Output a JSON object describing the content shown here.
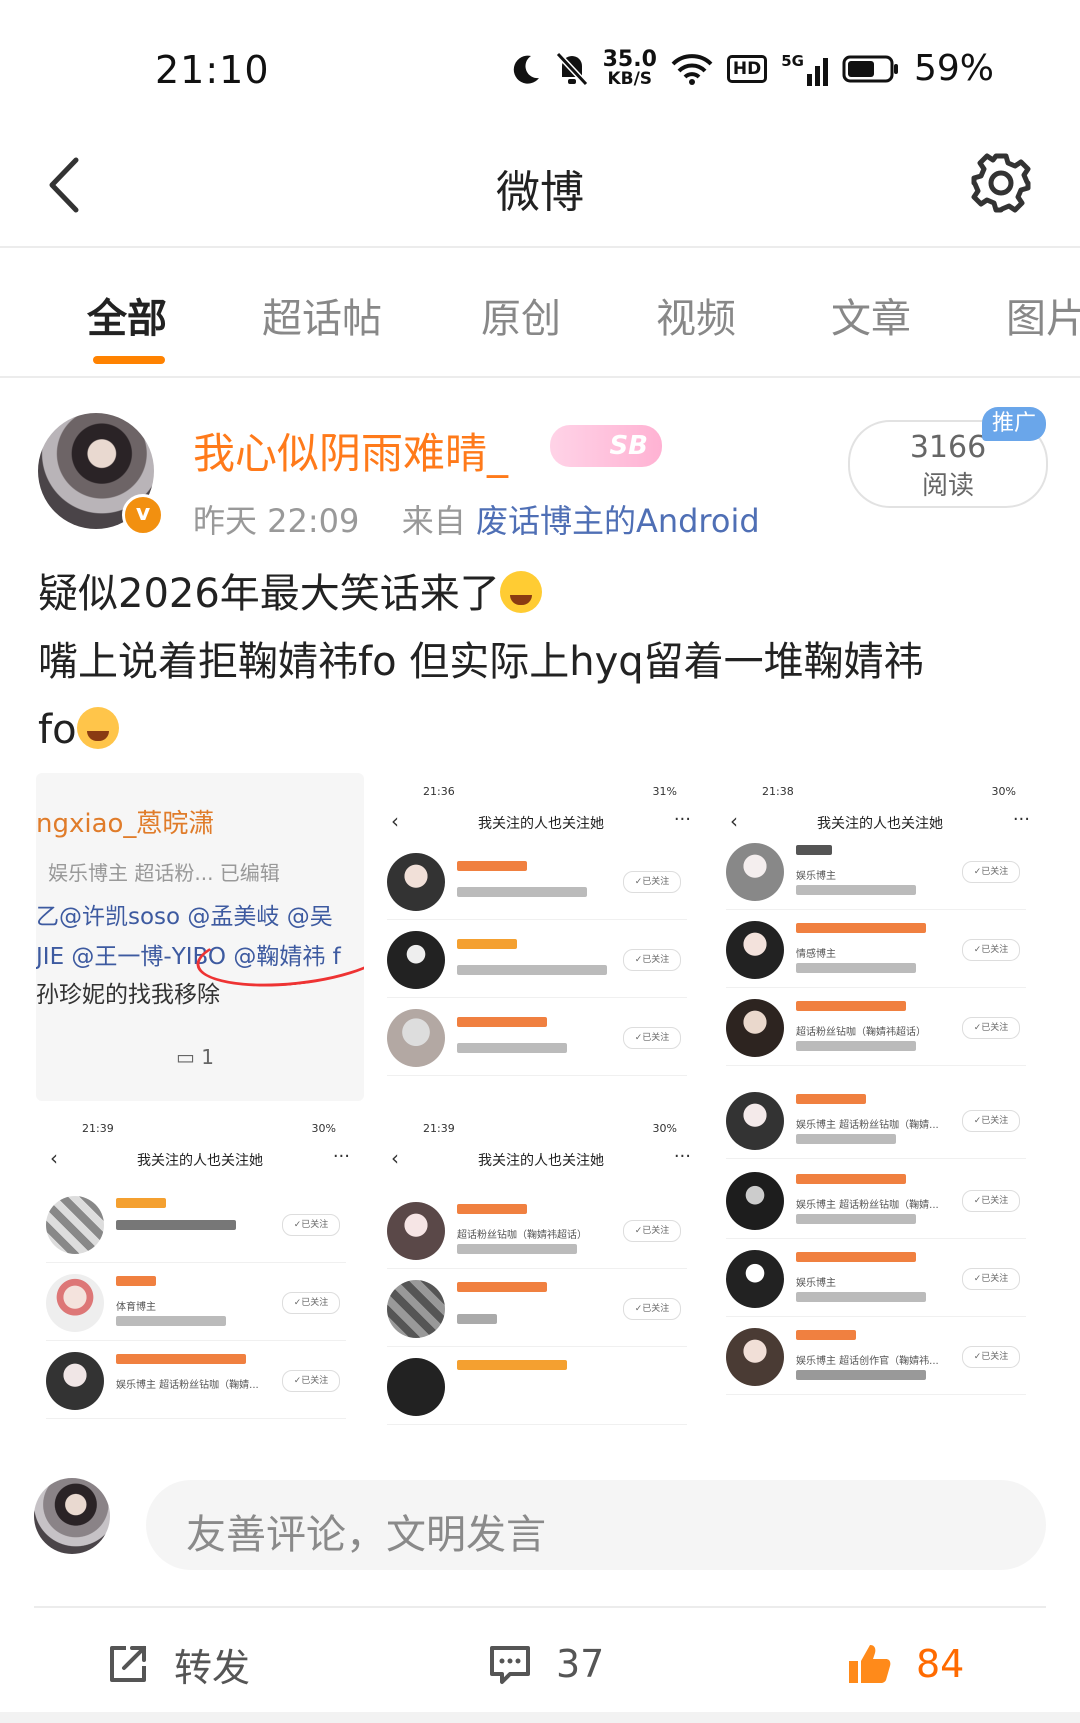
{
  "status_bar": {
    "time": "21:10",
    "net_speed_value": "35.0",
    "net_speed_unit": "KB/S",
    "hd": "HD",
    "network": "5G",
    "battery": "59%"
  },
  "nav": {
    "title": "微博",
    "back_icon": "chevron-left-icon",
    "settings_icon": "gear-icon"
  },
  "tabs": [
    {
      "label": "全部",
      "active": true
    },
    {
      "label": "超话帖",
      "active": false
    },
    {
      "label": "原创",
      "active": false
    },
    {
      "label": "视频",
      "active": false
    },
    {
      "label": "文章",
      "active": false
    },
    {
      "label": "图片",
      "active": false
    }
  ],
  "post": {
    "username": "我心似阴雨难晴_",
    "user_tag": "SB",
    "time": "昨天 22:09",
    "source_prefix": "来自",
    "source": "废话博主的Android",
    "reads_count": "3166",
    "reads_label": "阅读",
    "promo_badge": "推广",
    "text_line1": "疑似2026年最大笑话来了",
    "text_line2": "嘴上说着拒鞠婧祎fo 但实际上hyq留着一堆鞠婧祎",
    "text_line3": "fo"
  },
  "images": {
    "img1": {
      "caption": "ngxiao_蒽晥潇",
      "sub": "娱乐博主 超话粉... 已编辑",
      "line1": "乙@许凯soso @孟美岐 @吴",
      "line2": "JIE @王一博-YIBO @鞠婧祎 f",
      "line3": "孙珍妮的找我移除",
      "comments": "1"
    },
    "img2": {
      "time": "21:36",
      "battery": "31%",
      "title": "我关注的人也关注她",
      "follow": "✓已关注"
    },
    "img3": {
      "time": "21:38",
      "battery": "30%",
      "title": "我关注的人也关注她",
      "follow": "✓已关注",
      "labels": [
        "娱乐博主",
        "情感博主",
        "超话粉丝钻咖（鞠婧祎超话）",
        "娱乐博主 超话粉丝钻咖（鞠婧...",
        "娱乐博主 超话粉丝钻咖（鞠婧...",
        "娱乐博主",
        "娱乐博主 超话创作官（鞠婧祎..."
      ]
    },
    "img4": {
      "time": "21:39",
      "battery": "30%",
      "title": "我关注的人也关注她",
      "follow": "✓已关注",
      "labels": [
        "体育博主",
        "娱乐博主 超话粉丝钻咖（鞠婧..."
      ]
    },
    "img5": {
      "time": "21:39",
      "battery": "30%",
      "title": "我关注的人也关注她",
      "follow": "✓已关注",
      "labels": [
        "超话粉丝钻咖（鞠婧祎超话）"
      ]
    }
  },
  "comment_box": {
    "placeholder": "友善评论，文明发言"
  },
  "actions": {
    "repost_label": "转发",
    "comment_count": "37",
    "like_count": "84"
  },
  "colors": {
    "accent": "#ff8200",
    "username": "#ff7a1a",
    "link": "#4f6fb5",
    "promo": "#6aa6ea"
  }
}
